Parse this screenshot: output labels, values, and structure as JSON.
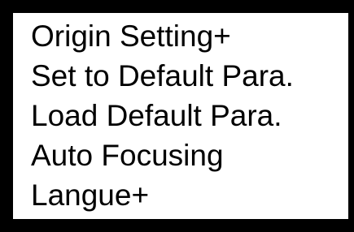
{
  "menu": {
    "items": [
      {
        "label": "Origin Setting+"
      },
      {
        "label": "Set to Default Para."
      },
      {
        "label": "Load Default Para."
      },
      {
        "label": "Auto Focusing"
      },
      {
        "label": "Langue+"
      }
    ]
  },
  "colors": {
    "frame": "#000000",
    "background": "#ffffff",
    "text": "#000000"
  }
}
